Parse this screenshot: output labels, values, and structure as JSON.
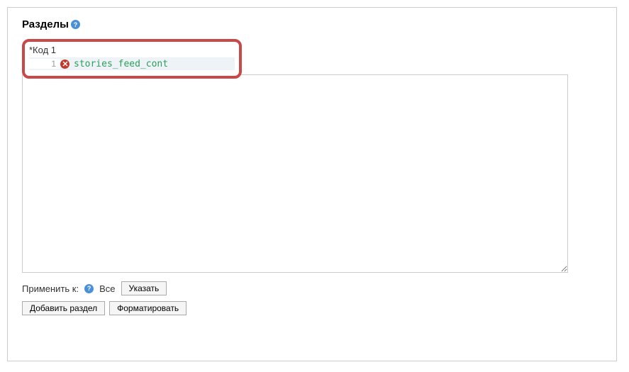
{
  "title": "Разделы",
  "code_section": {
    "label": "*Код 1",
    "line_number": "1",
    "code": "stories_feed_cont"
  },
  "apply": {
    "label": "Применить к:",
    "value": "Все",
    "specify_btn": "Указать"
  },
  "buttons": {
    "add_section": "Добавить раздел",
    "format": "Форматировать"
  }
}
